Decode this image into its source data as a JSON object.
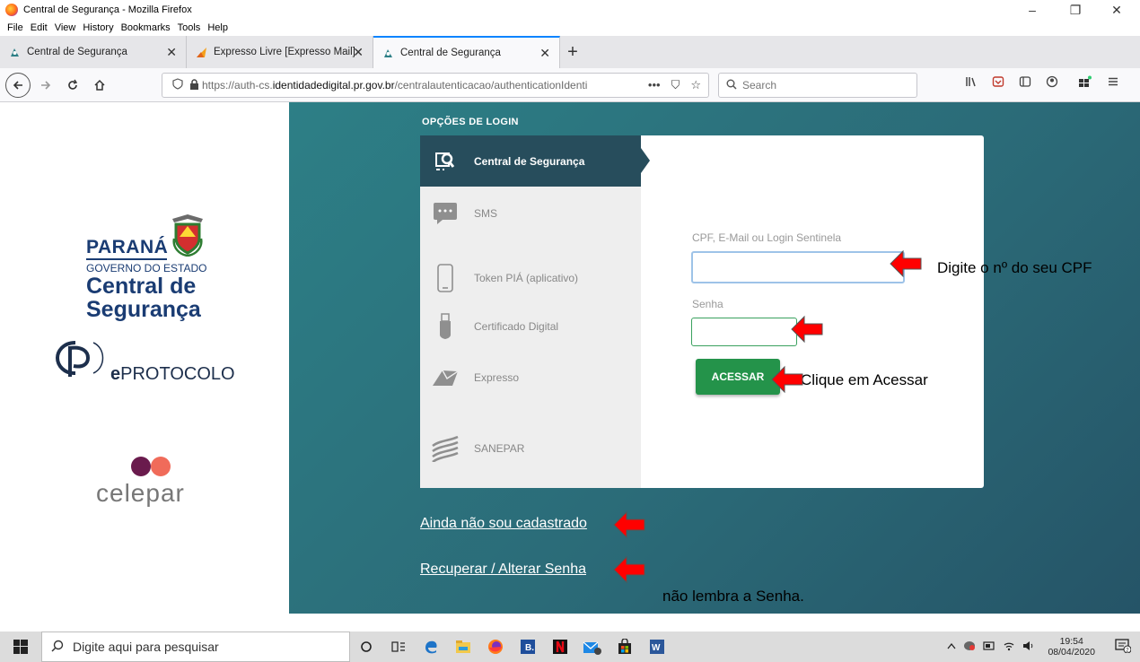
{
  "window": {
    "title": "Central de Segurança - Mozilla Firefox",
    "controls": {
      "minimize": "–",
      "maximize": "❐",
      "close": "✕"
    }
  },
  "menu": [
    "File",
    "Edit",
    "View",
    "History",
    "Bookmarks",
    "Tools",
    "Help"
  ],
  "tabs": [
    {
      "label": "Central de Segurança",
      "close": "✕"
    },
    {
      "label": "Expresso Livre [Expresso Mail]",
      "close": "✕"
    },
    {
      "label": "Central de Segurança",
      "close": "✕"
    }
  ],
  "newtab": "+",
  "nav": {
    "url_prefix": "https://auth-cs.",
    "url_host": "identidadedigital.pr.gov.br",
    "url_path": "/centralautenticacao/authenticationIdenti",
    "url_actions": [
      "•••",
      "⛉",
      "☆"
    ],
    "search_placeholder": "Search"
  },
  "branding": {
    "parana": "PARANÁ",
    "governo": "GOVERNO DO ESTADO",
    "central_line1": "Central de",
    "central_line2": "Segurança",
    "eprotocolo_e": "e",
    "eprotocolo_rest": "PROTOCOLO",
    "celepar": "celepar"
  },
  "login": {
    "heading": "OPÇÕES DE LOGIN",
    "options": [
      {
        "label": "Central de Segurança",
        "icon": "search-shield-icon",
        "active": true
      },
      {
        "label": "SMS",
        "icon": "sms-icon",
        "active": false
      },
      {
        "label": "Token PIÁ (aplicativo)",
        "icon": "phone-icon",
        "active": false
      },
      {
        "label": "Certificado Digital",
        "icon": "usb-token-icon",
        "active": false
      },
      {
        "label": "Expresso",
        "icon": "mail-icon",
        "active": false
      },
      {
        "label": "SANEPAR",
        "icon": "sanepar-icon",
        "active": false
      }
    ],
    "cpf_label": "CPF, E-Mail ou Login Sentinela",
    "cpf_value": "",
    "senha_label": "Senha",
    "senha_value": "",
    "button": "ACESSAR"
  },
  "links": {
    "cadastro": "Ainda não sou cadastrado",
    "recuperar": "Recuperar / Alterar Senha"
  },
  "annotations": {
    "cpf": "Digite o nº do seu CPF",
    "acessar": "Clique em Acessar",
    "senha": "não lembra a Senha."
  },
  "taskbar": {
    "search_placeholder": "Digite aqui para pesquisar",
    "time": "19:54",
    "date": "08/04/2020",
    "notifications": "2"
  },
  "colors": {
    "teal_bg": "#2b6b78",
    "active_option": "#274d5c",
    "button_green": "#24934a",
    "arrow_red": "#ff0000",
    "brand_blue": "#1a3c73"
  }
}
